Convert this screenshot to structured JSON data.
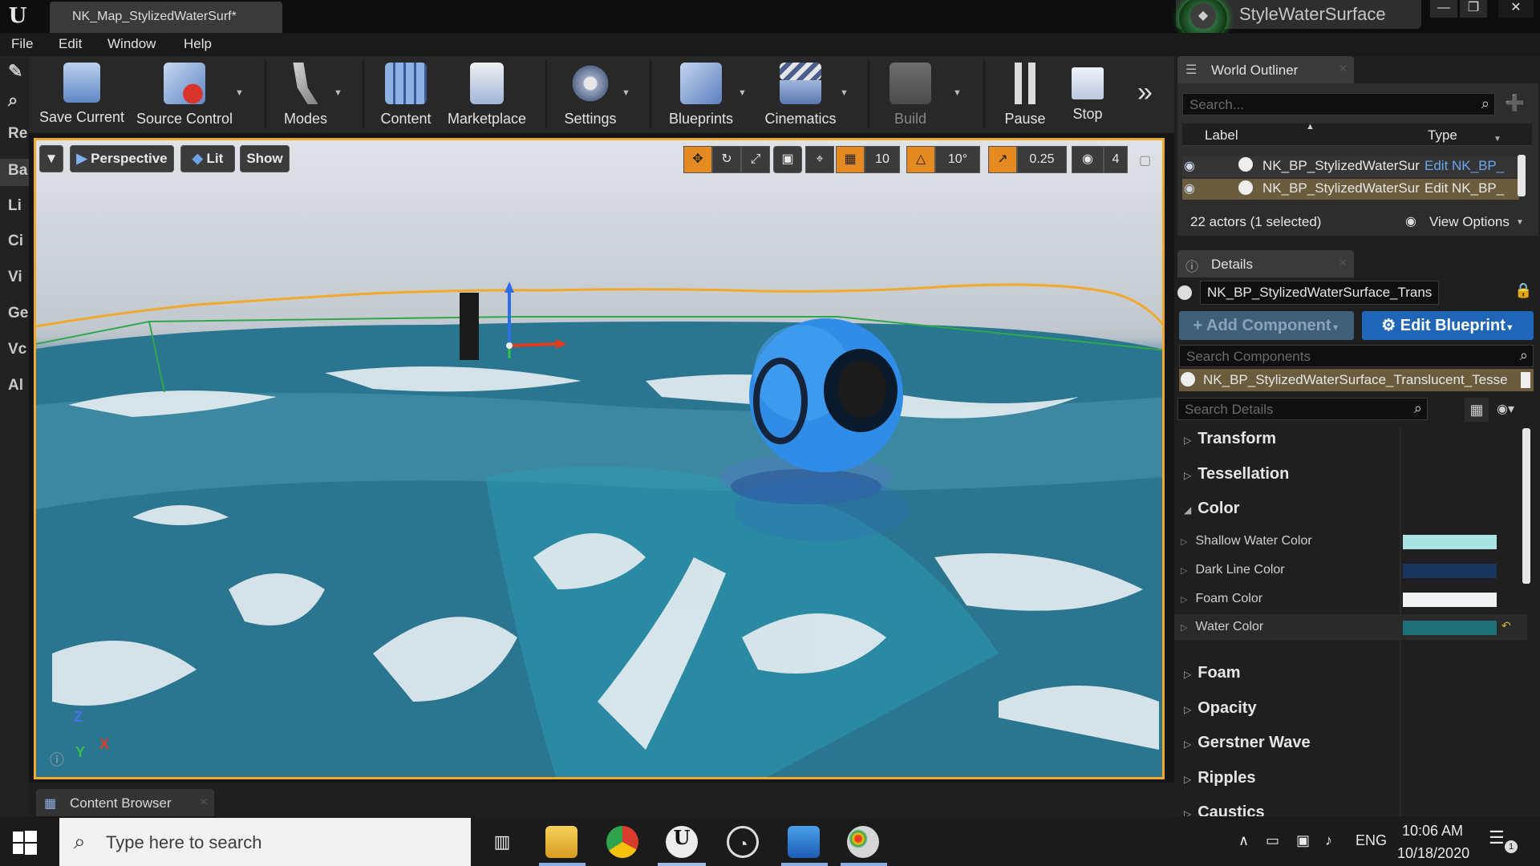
{
  "window": {
    "doc_tab": "NK_Map_StylizedWaterSurf*",
    "project_name": "StyleWaterSurface",
    "controls": [
      "—",
      "❐",
      "✕"
    ]
  },
  "menu": [
    "File",
    "Edit",
    "Window",
    "Help"
  ],
  "left_tabs": [
    "Re",
    "Ba",
    "Li",
    "Ci",
    "Vi",
    "Ge",
    "Vc",
    "Al"
  ],
  "toolbar": {
    "buttons": [
      {
        "label": "Save Current"
      },
      {
        "label": "Source Control"
      },
      {
        "label": "Modes"
      },
      {
        "label": "Content"
      },
      {
        "label": "Marketplace"
      },
      {
        "label": "Settings"
      },
      {
        "label": "Blueprints"
      },
      {
        "label": "Cinematics"
      },
      {
        "label": "Build"
      },
      {
        "label": "Pause"
      },
      {
        "label": "Stop"
      }
    ],
    "more": "»"
  },
  "viewport": {
    "perspective": "Perspective",
    "lit": "Lit",
    "show": "Show",
    "grid_snap": "10",
    "rotation_snap": "10°",
    "scale_snap": "0.25",
    "camera_speed": "4",
    "axis": {
      "z": "Z",
      "x": "X",
      "y": "Y"
    }
  },
  "outliner": {
    "tab": "World Outliner",
    "search_placeholder": "Search...",
    "col_label": "Label",
    "col_type": "Type",
    "rows": [
      {
        "label": "NK_BP_StylizedWaterSur",
        "type": "Edit NK_BP_"
      },
      {
        "label": "NK_BP_StylizedWaterSur",
        "type": "Edit NK_BP_"
      }
    ],
    "status": "22 actors (1 selected)",
    "view_options": "View Options"
  },
  "details": {
    "tab": "Details",
    "actor_name": "NK_BP_StylizedWaterSurface_Trans",
    "add_component": "+ Add Component",
    "edit_blueprint": "Edit Blueprint",
    "search_components": "Search Components",
    "component": "NK_BP_StylizedWaterSurface_Translucent_Tesse",
    "search_details": "Search Details",
    "categories_top": [
      "Transform",
      "Tessellation",
      "Color"
    ],
    "color_props": [
      {
        "label": "Shallow Water Color",
        "color": "#a8e2e2"
      },
      {
        "label": "Dark Line Color",
        "color": "#1a3560"
      },
      {
        "label": "Foam Color",
        "color": "#eef2f2"
      },
      {
        "label": "Water Color",
        "color": "#1f6f78"
      }
    ],
    "categories_bottom": [
      "Foam",
      "Opacity",
      "Gerstner Wave",
      "Ripples",
      "Caustics"
    ]
  },
  "content_browser": {
    "tab": "Content Browser"
  },
  "taskbar": {
    "search_placeholder": "Type here to search",
    "language": "ENG",
    "time": "10:06 AM",
    "date": "10/18/2020",
    "notifications": "1"
  }
}
